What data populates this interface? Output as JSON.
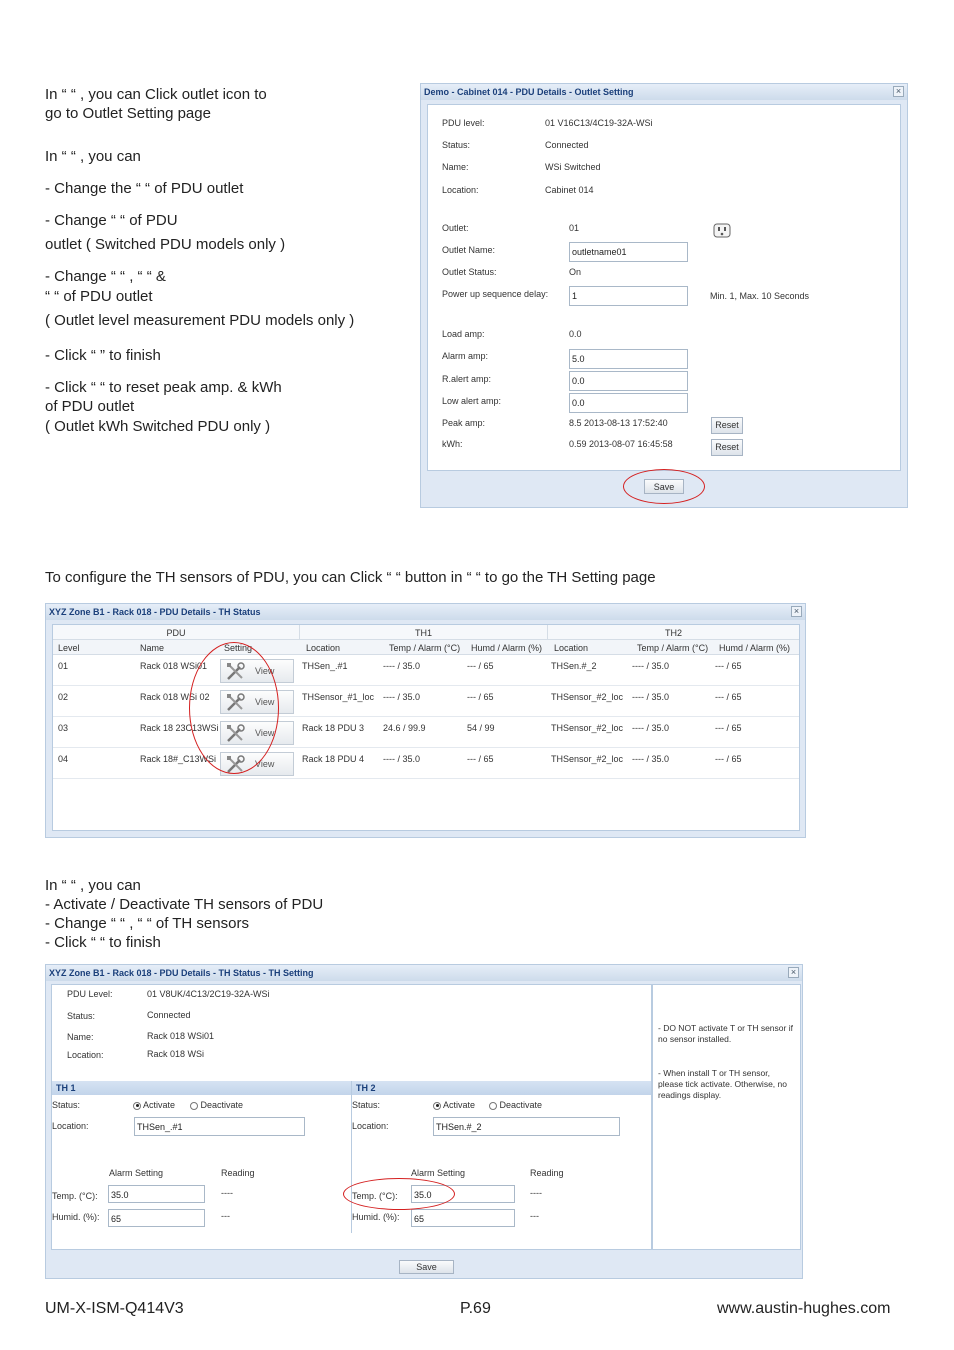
{
  "section1": {
    "lines": [
      "In “                    “ , you can Click outlet icon to",
      "go to Outlet Setting page",
      "In “                        “ , you can",
      "-  Change the “             “ of PDU outlet",
      "-  Change “                                        “ of PDU",
      "    outlet ( Switched PDU models only )",
      "-  Change “                    “ , “                         “ &",
      "    “                        “ of PDU outlet",
      "    ( Outlet level  measurement PDU models only )",
      "-  Click “          ” to finish",
      "-  Click “          “ to reset peak amp. & kWh",
      "     of PDU outlet",
      "    ( Outlet kWh Switched PDU only )"
    ]
  },
  "outlet_window": {
    "title": "Demo - Cabinet 014 - PDU Details - Outlet Setting",
    "close": "×",
    "info": [
      {
        "label": "PDU level:",
        "value": "01 V16C13/4C19-32A-WSi"
      },
      {
        "label": "Status:",
        "value": "Connected"
      },
      {
        "label": "Name:",
        "value": "WSi Switched"
      },
      {
        "label": "Location:",
        "value": "Cabinet 014"
      }
    ],
    "outlet_label": "Outlet:",
    "outlet_value": "01",
    "outlet_name_label": "Outlet Name:",
    "outlet_name_value": "outletname01",
    "outlet_status_label": "Outlet Status:",
    "outlet_status_value": "On",
    "power_delay_label": "Power up sequence delay:",
    "power_delay_value": "1",
    "power_delay_hint": "Min. 1, Max. 10 Seconds",
    "load_amp_label": "Load amp:",
    "load_amp_value": "0.0",
    "alarm_amp_label": "Alarm amp:",
    "alarm_amp_value": "5.0",
    "ralert_amp_label": "R.alert amp:",
    "ralert_amp_value": "0.0",
    "low_alert_label": "Low alert amp:",
    "low_alert_value": "0.0",
    "peak_amp_label": "Peak amp:",
    "peak_amp_value": "8.5 2013-08-13 17:52:40",
    "kwh_label": "kWh:",
    "kwh_value": "0.59 2013-08-07 16:45:58",
    "reset_label": "Reset",
    "save_label": "Save"
  },
  "section2": {
    "line": "To configure the TH sensors of PDU, you can Click “          “ button in “                  “ to go the TH Setting page"
  },
  "th_status_window": {
    "title": "XYZ Zone B1 - Rack 018 - PDU Details - TH Status",
    "close": "×",
    "group_pdu": "PDU",
    "group_th1": "TH1",
    "group_th2": "TH2",
    "col_level": "Level",
    "col_name": "Name",
    "col_setting": "Setting",
    "col_location": "Location",
    "col_temp": "Temp / Alarm (°C)",
    "col_humid": "Humd / Alarm (%)",
    "view_label": "View",
    "rows": [
      {
        "level": "01",
        "name": "Rack 018 WSi01",
        "th1_loc": "THSen_.#1",
        "th1_temp": "---- / 35.0",
        "th1_humid": "--- / 65",
        "th2_loc": "THSen.#_2",
        "th2_temp": "---- / 35.0",
        "th2_humid": "--- / 65"
      },
      {
        "level": "02",
        "name": "Rack 018 WSi 02",
        "th1_loc": "THSensor_#1_loc",
        "th1_temp": "---- / 35.0",
        "th1_humid": "--- / 65",
        "th2_loc": "THSensor_#2_loc",
        "th2_temp": "---- / 35.0",
        "th2_humid": "--- / 65"
      },
      {
        "level": "03",
        "name": "Rack 18 23C13WSi",
        "th1_loc": "Rack 18 PDU 3",
        "th1_temp": "24.6 / 99.9",
        "th1_humid": "54 / 99",
        "th2_loc": "THSensor_#2_loc",
        "th2_temp": "---- / 35.0",
        "th2_humid": "--- / 65"
      },
      {
        "level": "04",
        "name": "Rack 18#_C13WSi",
        "th1_loc": "Rack 18 PDU 4",
        "th1_temp": "---- / 35.0",
        "th1_humid": "--- / 65",
        "th2_loc": "THSensor_#2_loc",
        "th2_temp": "---- / 35.0",
        "th2_humid": "--- / 65"
      }
    ]
  },
  "section3": {
    "lines": [
      "In “                  “ , you can",
      "-  Activate / Deactivate TH sensors of PDU",
      "-  Change “                  “ , “                            “ of TH sensors",
      "-  Click “          “ to finish"
    ]
  },
  "th_setting_window": {
    "title": "XYZ Zone B1 - Rack 018 - PDU Details - TH Status - TH Setting",
    "close": "×",
    "info": [
      {
        "label": "PDU Level:",
        "value": "01 V8UK/4C13/2C19-32A-WSi"
      },
      {
        "label": "Status:",
        "value": "Connected"
      },
      {
        "label": "Name:",
        "value": "Rack 018 WSi01"
      },
      {
        "label": "Location:",
        "value": "Rack 018 WSi"
      }
    ],
    "note1": "- DO NOT activate T or TH sensor if no sensor installed.",
    "note2": "- When install T or TH sensor, please tick activate. Otherwise, no readings display.",
    "th1": {
      "header": "TH 1",
      "status_label": "Status:",
      "activate": "Activate",
      "deactivate": "Deactivate",
      "location_label": "Location:",
      "location_value": "THSen_.#1",
      "alarm_setting": "Alarm Setting",
      "reading": "Reading",
      "temp_label": "Temp. (°C):",
      "temp_value": "35.0",
      "temp_reading": "----",
      "humid_label": "Humid. (%):",
      "humid_value": "65",
      "humid_reading": "---"
    },
    "th2": {
      "header": "TH 2",
      "status_label": "Status:",
      "activate": "Activate",
      "deactivate": "Deactivate",
      "location_label": "Location:",
      "location_value": "THSen.#_2",
      "alarm_setting": "Alarm Setting",
      "reading": "Reading",
      "temp_label": "Temp. (°C):",
      "temp_value": "35.0",
      "temp_reading": "----",
      "humid_label": "Humid. (%):",
      "humid_value": "65",
      "humid_reading": "---"
    },
    "save_label": "Save"
  },
  "footer": {
    "doc_id": "UM-X-ISM-Q414V3",
    "page": "P.69",
    "website": "www.austin-hughes.com"
  }
}
